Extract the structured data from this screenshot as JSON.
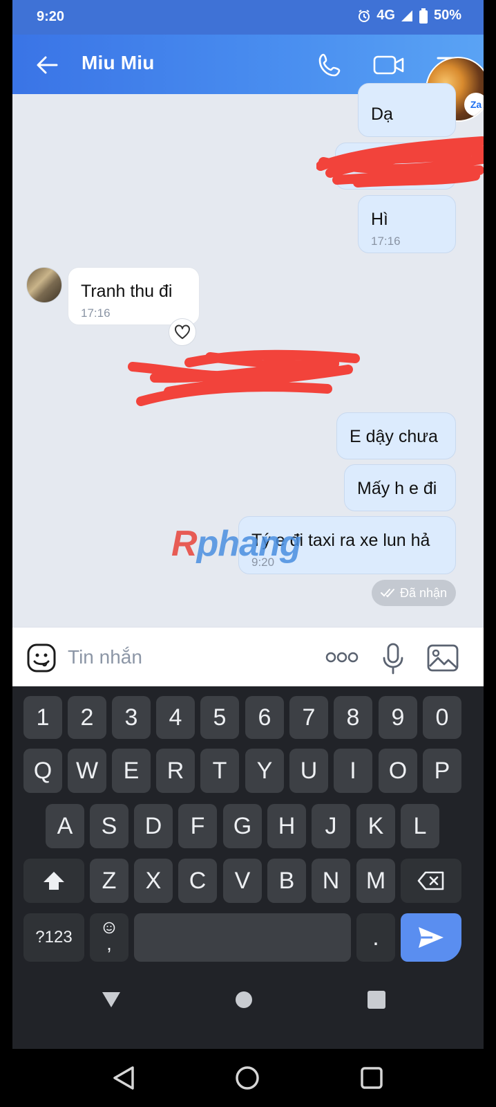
{
  "status_bar": {
    "time": "9:20",
    "network": "4G",
    "battery": "50%"
  },
  "header": {
    "title": "Miu Miu",
    "floating_badge": "Za"
  },
  "messages": [
    {
      "text": "Dạ"
    },
    {
      "text": "Hì",
      "time": "17:16"
    },
    {
      "text": "Tranh thu đi",
      "time": "17:16"
    },
    {
      "text": "E dậy chưa"
    },
    {
      "text": "Mấy h e đi"
    },
    {
      "text": "Tý e đi taxi ra xe lun hả",
      "time": "9:20"
    }
  ],
  "seen_status": "Đã nhận",
  "watermark": {
    "r": "R",
    "rest": "phang"
  },
  "input": {
    "placeholder": "Tin nhắn"
  },
  "keyboard": {
    "numbers": [
      "1",
      "2",
      "3",
      "4",
      "5",
      "6",
      "7",
      "8",
      "9",
      "0"
    ],
    "row1": [
      "Q",
      "W",
      "E",
      "R",
      "T",
      "Y",
      "U",
      "I",
      "O",
      "P"
    ],
    "row2": [
      "A",
      "S",
      "D",
      "F",
      "G",
      "H",
      "J",
      "K",
      "L"
    ],
    "row3": [
      "Z",
      "X",
      "C",
      "V",
      "B",
      "N",
      "M"
    ],
    "symbols_key": "?123",
    "emoji_comma_sub": ",",
    "period": "."
  },
  "colors": {
    "header": "#3a74e6",
    "sent_bubble": "#dcebfd",
    "keyboard": "#212328",
    "send_key": "#5a8ef0"
  }
}
